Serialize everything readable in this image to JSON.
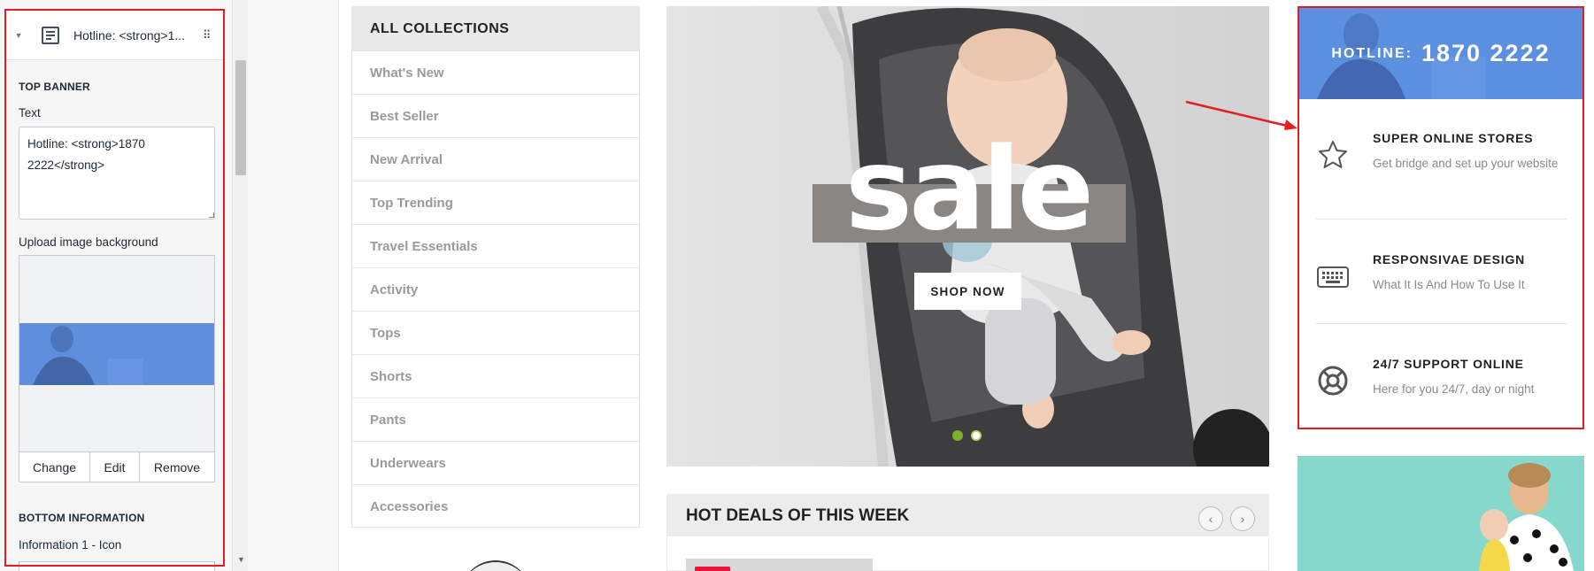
{
  "editor": {
    "block_title": "Hotline: <strong>1...",
    "section_top_banner": "TOP BANNER",
    "text_label": "Text",
    "text_value": "Hotline: <strong>1870 2222</strong>",
    "upload_label": "Upload image background",
    "buttons": {
      "change": "Change",
      "edit": "Edit",
      "remove": "Remove"
    },
    "section_bottom_info": "BOTTOM INFORMATION",
    "info1_icon_label": "Information 1 - Icon"
  },
  "collections": {
    "heading": "ALL COLLECTIONS",
    "items": [
      "What's New",
      "Best Seller",
      "New Arrival",
      "Top Trending",
      "Travel Essentials",
      "Activity",
      "Tops",
      "Shorts",
      "Pants",
      "Underwears",
      "Accessories"
    ]
  },
  "hero": {
    "headline": "sale",
    "cta": "SHOP NOW",
    "slides": 2,
    "active_slide": 1
  },
  "deals": {
    "heading": "HOT DEALS OF THIS WEEK",
    "prev": "‹",
    "next": "›"
  },
  "info_box": {
    "hotline_label": "HOTLINE:",
    "hotline_number": "1870 2222",
    "features": [
      {
        "icon": "star-icon",
        "title": "SUPER ONLINE STORES",
        "desc": "Get bridge and set up your website"
      },
      {
        "icon": "keyboard-icon",
        "title": "RESPONSIVAE DESIGN",
        "desc": "What It Is And How To Use It"
      },
      {
        "icon": "lifebuoy-icon",
        "title": "24/7 SUPPORT ONLINE",
        "desc": "Here for you 24/7, day or night"
      }
    ]
  },
  "colors": {
    "highlight": "#e51c23",
    "hotline_bg": "#5b8fe0",
    "active_dot": "#7cb227",
    "promo_bg": "#86d8cd"
  }
}
